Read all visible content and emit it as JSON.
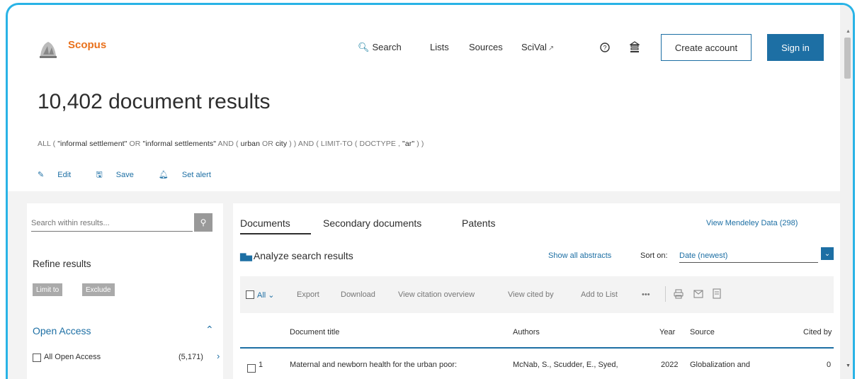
{
  "header": {
    "brand": "Scopus",
    "nav": {
      "search": "Search",
      "lists": "Lists",
      "sources": "Sources",
      "scival": "SciVal",
      "scival_ext": "↗"
    },
    "create_account": "Create account",
    "sign_in": "Sign in"
  },
  "results": {
    "title": "10,402 document results",
    "query": {
      "q1": "ALL ( ",
      "q2": "\"informal settlement\"",
      "q3": " OR ",
      "q4": "\"informal settlements\"",
      "q5": " AND ( ",
      "q6": "urban",
      "q7": " OR ",
      "q8": "city",
      "q9": " ) ) AND ( LIMIT-TO ( DOCTYPE , ",
      "q10": "\"ar\"",
      "q11": " ) )"
    },
    "actions": {
      "edit": "Edit",
      "save": "Save",
      "set_alert": "Set alert"
    }
  },
  "filters": {
    "search_placeholder": "Search within results...",
    "refine_title": "Refine results",
    "limit_to": "Limit to",
    "exclude": "Exclude",
    "open_access_title": "Open Access",
    "all_open_access": "All Open Access",
    "all_open_access_count": "(5,171)"
  },
  "documents": {
    "tabs": [
      "Documents",
      "Secondary documents",
      "Patents"
    ],
    "mendeley": "View Mendeley Data (298)",
    "analyze": "Analyze search results",
    "show_abstracts": "Show all abstracts",
    "sort_on": "Sort on:",
    "sort_value": "Date (newest)",
    "toolbar": {
      "all": "All",
      "export": "Export",
      "download": "Download",
      "citation_overview": "View citation overview",
      "cited_by": "View cited by",
      "add_to_list": "Add to List",
      "more": "•••"
    },
    "columns": {
      "title": "Document title",
      "authors": "Authors",
      "year": "Year",
      "source": "Source",
      "cited_by": "Cited by"
    },
    "rows": [
      {
        "num": "1",
        "title": "Maternal and newborn health for the urban poor:",
        "authors": "McNab, S., Scudder, E., Syed,",
        "year": "2022",
        "source": "Globalization and",
        "cited": "0"
      }
    ]
  }
}
